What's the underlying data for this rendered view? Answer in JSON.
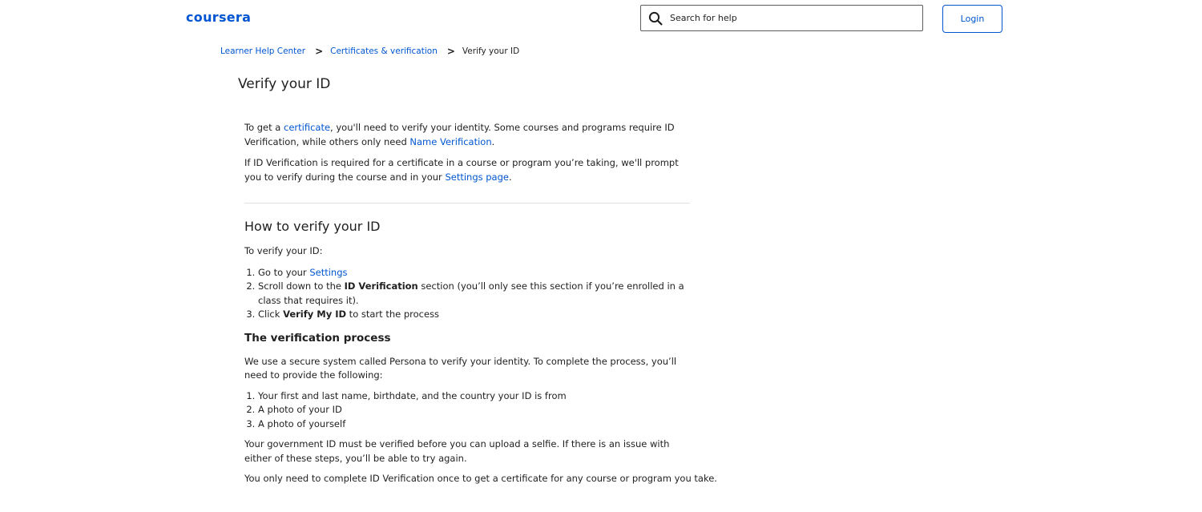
{
  "header": {
    "logo_text": "coursera",
    "search_placeholder": "Search for help",
    "login_label": "Login",
    "brand_color": "#0056d2",
    "search_icon": "search-icon"
  },
  "breadcrumb": {
    "items": [
      "Learner Help Center",
      "Certificates & verification",
      "Verify your ID"
    ],
    "separator": ">"
  },
  "page": {
    "title": "Verify your ID"
  },
  "article": {
    "intro1": {
      "pre": "To get a ",
      "link1": "certificate",
      "mid": ", you'll need to verify your identity. Some courses and programs require ID Verification, while others only need ",
      "link2": "Name Verification",
      "post": "."
    },
    "intro2": {
      "pre": "If ID Verification is required for a certificate in a course or program you’re taking, we'll prompt you to verify during the course and in your ",
      "link": "Settings page",
      "post": "."
    },
    "how_to": {
      "heading": "How to verify your ID",
      "lead": "To verify your ID:",
      "step1_pre": "Go to your ",
      "step1_link": "Settings",
      "step2_pre": "Scroll down to the ",
      "step2_bold": "ID Verification",
      "step2_post": " section (you’ll only see this section if you’re enrolled in a class that requires it).",
      "step3_pre": "Click ",
      "step3_bold": "Verify My ID",
      "step3_post": " to start the process"
    },
    "process": {
      "heading": "The verification process",
      "lead": "We use a secure system called Persona to verify your identity. To complete the process, you’ll need to provide the following:",
      "items": [
        "Your first and last name, birthdate, and the country your ID is from",
        "A photo of your ID",
        "A photo of yourself"
      ],
      "para1": "Your government ID must be verified before you can upload a selfie. If there is an issue with either of these steps, you’ll be able to try again.",
      "para2": "You only need to complete ID Verification once to get a certificate for any course or program you take."
    }
  }
}
